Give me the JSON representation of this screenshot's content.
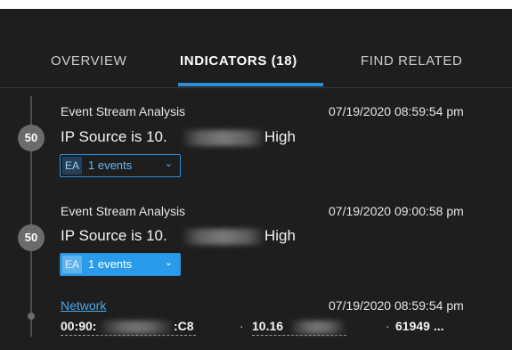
{
  "tabs": [
    {
      "label": "OVERVIEW",
      "active": false
    },
    {
      "label": "INDICATORS (18)",
      "active": true
    },
    {
      "label": "FIND RELATED",
      "active": false
    }
  ],
  "indicators": [
    {
      "score": "50",
      "source": "Event Stream Analysis",
      "timestamp": "07/19/2020 08:59:54 pm",
      "title_prefix": "IP Source is 10.",
      "title_suffix": "High",
      "events_badge": "EA",
      "events_label": "1 events",
      "events_style": "outline"
    },
    {
      "score": "50",
      "source": "Event Stream Analysis",
      "timestamp": "07/19/2020 09:00:58 pm",
      "title_prefix": "IP Source is 10.",
      "title_suffix": "High",
      "events_badge": "EA",
      "events_label": "1 events",
      "events_style": "filled"
    }
  ],
  "network_event": {
    "link": "Network",
    "timestamp": "07/19/2020 08:59:54 pm",
    "mac_prefix": "00:90:",
    "mac_suffix": ":C8",
    "ip_prefix": "10.16",
    "port": "61949 ..."
  },
  "colors": {
    "panel_bg": "#1e1e1e",
    "accent": "#2a8fd8",
    "score_bg": "#6b6b6b"
  }
}
